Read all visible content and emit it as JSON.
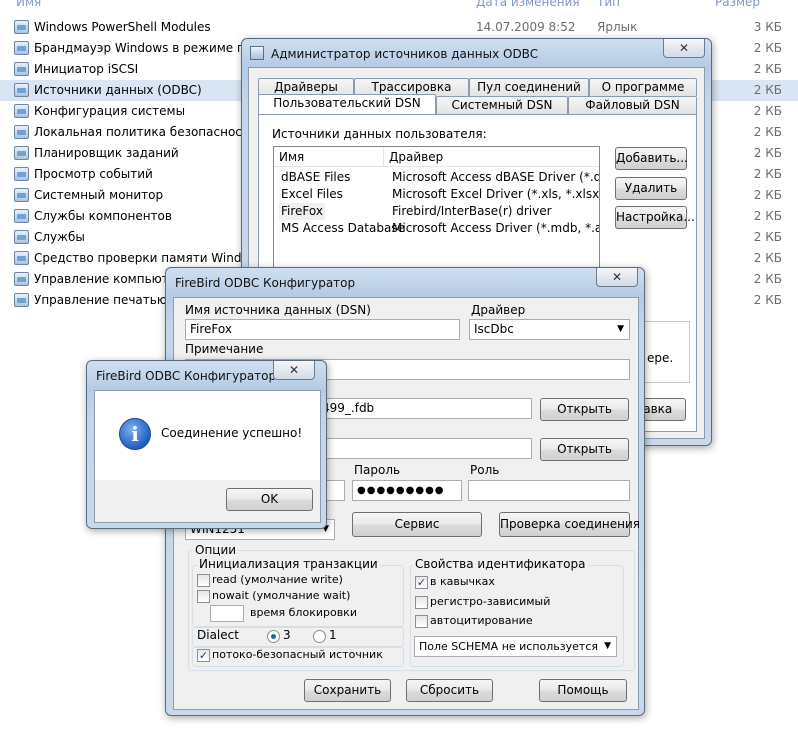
{
  "explorer": {
    "headers": {
      "name": "Имя",
      "date": "Дата изменения",
      "type": "Тип",
      "size": "Размер"
    },
    "items": [
      {
        "name": "Windows PowerShell Modules",
        "date": "14.07.2009 8:52",
        "type": "Ярлык",
        "size": "3 КБ"
      },
      {
        "name": "Брандмауэр Windows в режиме повы",
        "size": "2 КБ"
      },
      {
        "name": "Инициатор iSCSI",
        "size": "2 КБ"
      },
      {
        "name": "Источники данных (ODBC)",
        "size": "2 КБ"
      },
      {
        "name": "Конфигурация системы",
        "size": "2 КБ"
      },
      {
        "name": "Локальная политика безопасности",
        "size": "2 КБ"
      },
      {
        "name": "Планировщик заданий",
        "size": "2 КБ"
      },
      {
        "name": "Просмотр событий",
        "size": "2 КБ"
      },
      {
        "name": "Системный монитор",
        "size": "2 КБ"
      },
      {
        "name": "Службы компонентов",
        "size": "2 КБ"
      },
      {
        "name": "Службы",
        "size": "2 КБ"
      },
      {
        "name": "Средство проверки памяти Windows",
        "size": "2 КБ"
      },
      {
        "name": "Управление компьютер",
        "size": "2 КБ"
      },
      {
        "name": "Управление печатью",
        "size": "2 КБ"
      }
    ]
  },
  "odbc_admin": {
    "title": "Администратор источников данных ODBC",
    "close_glyph": "✕",
    "tabs_row1": [
      "Драйверы",
      "Трассировка",
      "Пул соединений",
      "О программе"
    ],
    "tabs_row2": [
      "Пользовательский DSN",
      "Системный DSN",
      "Файловый DSN"
    ],
    "section_label": "Источники данных пользователя:",
    "columns": [
      "Имя",
      "Драйвер"
    ],
    "rows": [
      {
        "name": "dBASE Files",
        "driver": "Microsoft Access dBASE Driver (*.dbf, *.ndx"
      },
      {
        "name": "Excel Files",
        "driver": "Microsoft Excel Driver (*.xls, *.xlsx, *.xlsm, *.x"
      },
      {
        "name": "FireFox",
        "driver": "Firebird/InterBase(r) driver"
      },
      {
        "name": "MS Access Database",
        "driver": "Microsoft Access Driver (*.mdb, *.accdb)"
      }
    ],
    "buttons": {
      "add": "Добавить...",
      "remove": "Удалить",
      "configure": "Настройка..."
    },
    "hint_fragment": "ере.",
    "help_fragment": "правка"
  },
  "fb_config": {
    "title": "FireBird ODBC Конфигуратор",
    "close_glyph": "✕",
    "dsn_label": "Имя источника данных (DSN)",
    "dsn_value": "FireFox",
    "driver_label": "Драйвер",
    "driver_value": "IscDbc",
    "note_label": "Примечание",
    "note_value": "",
    "db_value_fragment": "_499_.fdb",
    "open_button": "Открыть",
    "open_button2": "Открыть",
    "password_label": "Пароль",
    "password_value": "●●●●●●●●●",
    "role_label": "Роль",
    "role_value": "",
    "charset_fragment": "WIN1251",
    "service_button": "Сервис",
    "test_button": "Проверка соединения",
    "options_label": "Опции",
    "txn_group_label": "Инициализация транзакции",
    "read_label": "read (умолчание write)",
    "nowait_label": "nowait (умолчание wait)",
    "lock_time_label": "время блокировки",
    "dialect_label": "Dialect",
    "dialect3_label": "3",
    "dialect1_label": "1",
    "threadsafe_label": "потоко-безопасный источник",
    "ident_group_label": "Свойства идентификатора",
    "quoted_label": "в кавычках",
    "case_label": "регистро-зависимый",
    "autoquote_label": "автоцитирование",
    "schema_value": "Поле SCHEMA не используется",
    "save_button": "Сохранить",
    "reset_button": "Сбросить",
    "help_button": "Помощь",
    "check_glyph": "✓"
  },
  "msgbox": {
    "title": "FireBird ODBC Конфигуратор",
    "close_glyph": "✕",
    "message": "Соединение успешно!",
    "info_glyph": "i",
    "ok_button": "OK"
  },
  "colors": {
    "selection": "#d9e5f3",
    "title_gradient_top": "#cfdff0",
    "info_icon": "#1f5fbf"
  }
}
